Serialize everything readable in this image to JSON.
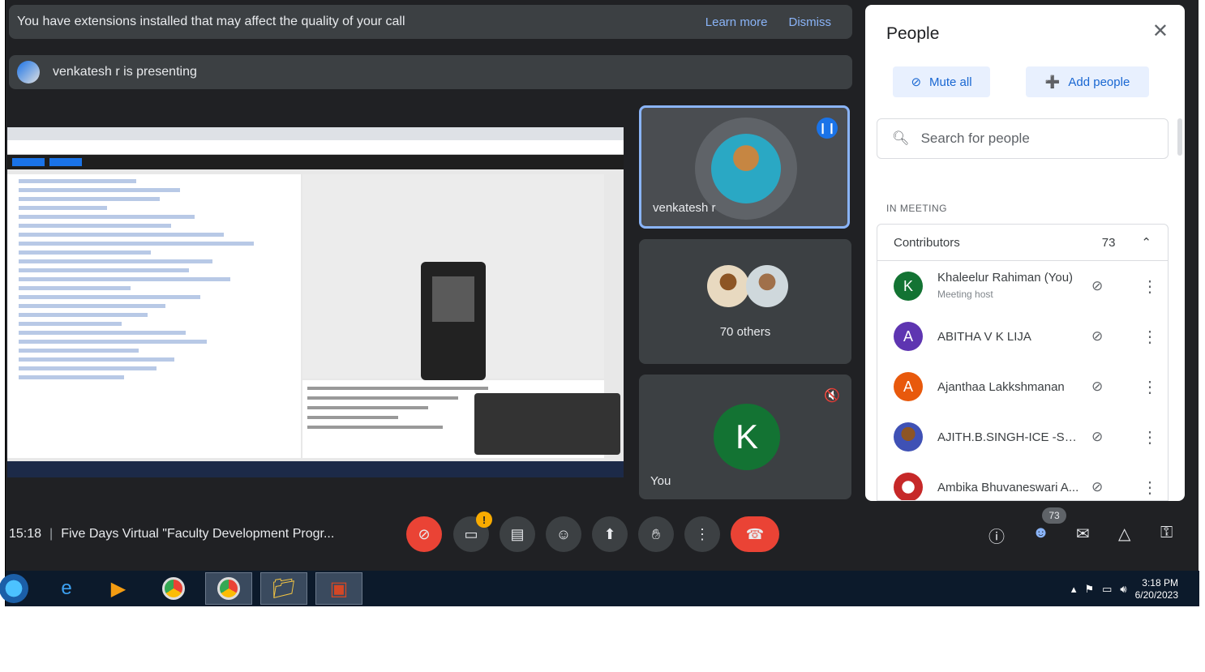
{
  "notice": {
    "message": "You have extensions installed that may affect the quality of your call",
    "learn_more": "Learn more",
    "dismiss": "Dismiss"
  },
  "presenting": {
    "text": "venkatesh r is presenting"
  },
  "tiles": {
    "presenter_name": "venkatesh r",
    "others_caption": "70 others",
    "self_initial": "K",
    "self_name": "You"
  },
  "people_panel": {
    "title": "People",
    "close_icon": "close-icon",
    "mute_all": "Mute all",
    "add_people": "Add people",
    "search_placeholder": "Search for people",
    "section_label": "IN MEETING",
    "group_label": "Contributors",
    "group_count": "73",
    "participants": [
      {
        "initial": "K",
        "name": "Khaleelur Rahiman (You)",
        "role": "Meeting host",
        "color": "#137333"
      },
      {
        "initial": "A",
        "name": "ABITHA V K LIJA",
        "role": "",
        "color": "#5e35b1"
      },
      {
        "initial": "A",
        "name": "Ajanthaa Lakkshmanan",
        "role": "",
        "color": "#e8590c"
      },
      {
        "initial": "",
        "name": "AJITH.B.SINGH-ICE -SK...",
        "role": "",
        "color": "#3f51b5"
      },
      {
        "initial": "",
        "name": "Ambika Bhuvaneswari A...",
        "role": "",
        "color": "#c62828"
      }
    ]
  },
  "controls": {
    "time": "15:18",
    "meeting_title": "Five Days Virtual \"Faculty Development Progr...",
    "camera_alert": "!",
    "people_badge": "73"
  },
  "taskbar": {
    "time": "3:18 PM",
    "date": "6/20/2023"
  },
  "colors": {
    "meet_background": "#202124",
    "danger": "#ea4335",
    "accent": "#8ab4f8"
  }
}
